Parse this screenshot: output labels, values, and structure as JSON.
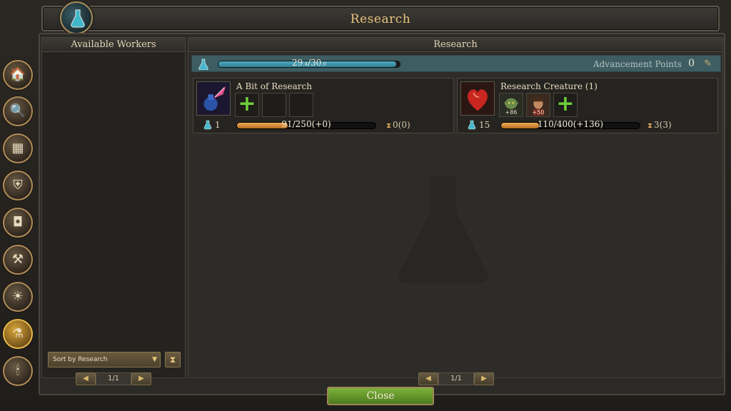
{
  "window": {
    "title": "Research"
  },
  "left_panel": {
    "header": "Available Workers",
    "sort_label": "Sort by Research",
    "pager_label": "1/1"
  },
  "right_panel": {
    "header": "Research",
    "advancement": {
      "current_text": "29",
      "current_decimal": ".4",
      "max_text": "30",
      "max_decimal": ".0",
      "fill_fraction": 0.98,
      "label": "Advancement Points",
      "value": "0"
    },
    "pager_label": "1/1"
  },
  "tasks": [
    {
      "name": "A Bit of Research",
      "level": "1",
      "progress_text": "91/250(+0)",
      "progress_fraction": 0.364,
      "time_text": "0(0)",
      "workers": [],
      "empty_slots": 2
    },
    {
      "name": "Research Creature (1)",
      "level": "15",
      "progress_text": "110/400(+136)",
      "progress_fraction": 0.275,
      "time_text": "3(3)",
      "workers": [
        {
          "bonus": "+86",
          "icon": "goblin-portrait"
        },
        {
          "bonus": "+50",
          "icon": "human-portrait"
        }
      ],
      "empty_slots": 0
    }
  ],
  "sidebar": [
    {
      "icon": "house-icon"
    },
    {
      "icon": "magnifier-icon"
    },
    {
      "icon": "crate-icon"
    },
    {
      "icon": "shield-icon"
    },
    {
      "icon": "chest-icon"
    },
    {
      "icon": "anvil-icon"
    },
    {
      "icon": "forge-icon"
    },
    {
      "icon": "flask-icon",
      "active": true
    },
    {
      "icon": "candle-icon"
    }
  ],
  "close_label": "Close"
}
